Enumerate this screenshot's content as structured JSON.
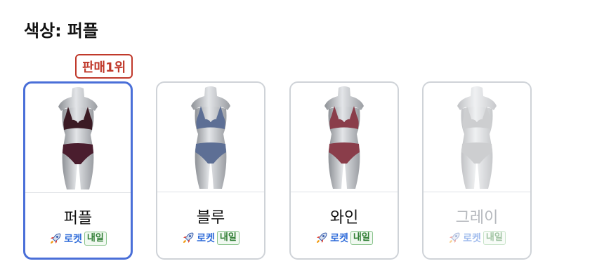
{
  "option": {
    "label": "색상:",
    "selected_value": "퍼플"
  },
  "badge": {
    "text": "판매1위"
  },
  "variants": [
    {
      "name": "퍼플",
      "rocket_label": "로켓",
      "tomorrow_label": "내일",
      "top_color": "#3b1b24",
      "bottom_color": "#4a1d2e",
      "selected": true,
      "disabled": false
    },
    {
      "name": "블루",
      "rocket_label": "로켓",
      "tomorrow_label": "내일",
      "top_color": "#5d6f95",
      "bottom_color": "#5d6f95",
      "selected": false,
      "disabled": false
    },
    {
      "name": "와인",
      "rocket_label": "로켓",
      "tomorrow_label": "내일",
      "top_color": "#8a3d4a",
      "bottom_color": "#8a3d4a",
      "selected": false,
      "disabled": false
    },
    {
      "name": "그레이",
      "rocket_label": "로켓",
      "tomorrow_label": "내일",
      "top_color": "#a4a6a9",
      "bottom_color": "#a4a6a9",
      "selected": false,
      "disabled": true
    }
  ],
  "colors": {
    "selected_border": "#4a6fd8",
    "badge": "#c0392b",
    "rocket_text": "#2e6bd9",
    "tomorrow_text": "#2e7d32"
  }
}
